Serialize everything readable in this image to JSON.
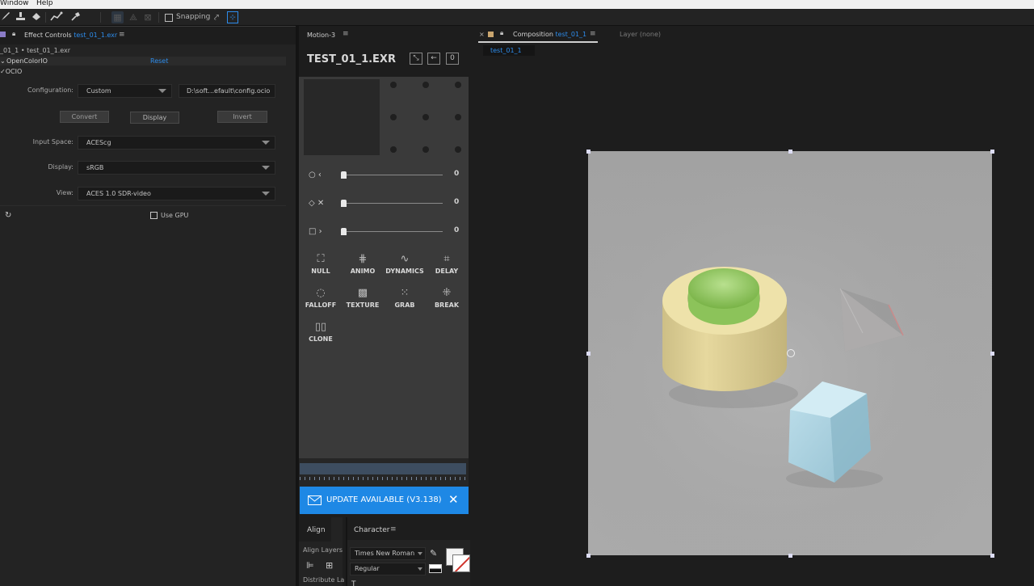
{
  "menubar": {
    "items": [
      "Window",
      "Help"
    ]
  },
  "toolbar": {
    "snapping_label": "Snapping"
  },
  "effect_controls": {
    "tab_title": "Effect Controls",
    "tab_file": "test_01_1.exr",
    "breadcrumb": "_01_1 • test_01_1.exr",
    "effect_name": "OpenColorIO",
    "reset_label": "Reset",
    "ocio_label": "OCIO",
    "configuration_label": "Configuration:",
    "configuration_value": "Custom",
    "config_path": "D:\\soft...efault\\config.ocio",
    "convert_label": "Convert",
    "display_button_label": "Display",
    "invert_label": "Invert",
    "input_space_label": "Input Space:",
    "input_space_value": "ACEScg",
    "display_label": "Display:",
    "display_value": "sRGB",
    "view_label": "View:",
    "view_value": "ACES 1.0 SDR-video",
    "use_gpu_label": "Use GPU"
  },
  "motion": {
    "tab_title": "Motion-3",
    "comp_name": "TEST_01_1.EXR",
    "slider_values": [
      "0",
      "0",
      "0"
    ],
    "tools_row1": [
      "NULL",
      "ANIMO",
      "DYNAMICS",
      "DELAY"
    ],
    "tools_row2": [
      "FALLOFF",
      "TEXTURE",
      "GRAB",
      "BREAK"
    ],
    "tools_row3": [
      "CLONE"
    ],
    "update_banner": "UPDATE AVAILABLE (V3.138)"
  },
  "align": {
    "tab_title": "Align",
    "align_layers_label": "Align Layers",
    "distribute_label": "Distribute La"
  },
  "character": {
    "tab_title": "Character",
    "font_name": "Times New Roman",
    "font_style": "Regular"
  },
  "composition": {
    "tab_prefix": "Composition",
    "tab_name": "test_01_1",
    "layer_label": "Layer (none)",
    "sub_tab": "test_01_1"
  },
  "colors": {
    "accent_blue": "#2d8ceb",
    "banner_blue": "#1e88e5",
    "canvas_gray": "#a7a7a7"
  }
}
